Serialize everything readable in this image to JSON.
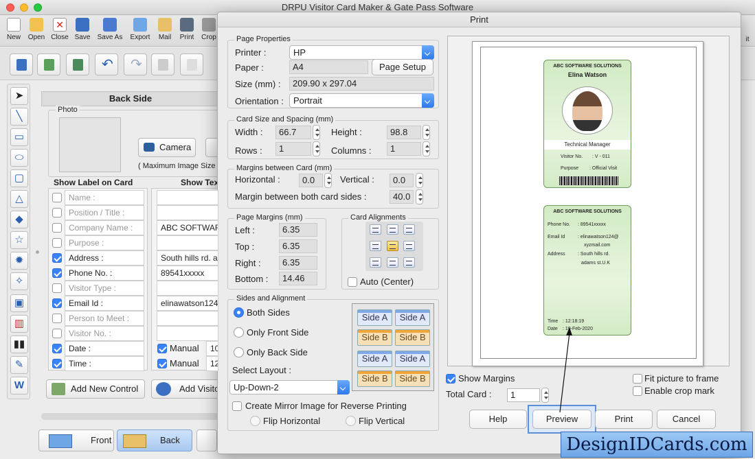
{
  "app_title": "DRPU Visitor Card Maker & Gate Pass Software",
  "toolbar": {
    "items": [
      {
        "label": "New"
      },
      {
        "label": "Open"
      },
      {
        "label": "Close"
      },
      {
        "label": "Save"
      },
      {
        "label": "Save As"
      },
      {
        "label": "Export"
      },
      {
        "label": "Mail"
      },
      {
        "label": "Print"
      },
      {
        "label": "Crop"
      }
    ],
    "exit_fragment": "it"
  },
  "editor": {
    "back_side_title": "Back Side",
    "photo_label": "Photo",
    "camera_button": "Camera",
    "max_image_size": "( Maximum Image Size",
    "show_label_header": "Show Label on Card",
    "show_text_header": "Show Tex",
    "labels": [
      {
        "text": "Name :",
        "checked": false,
        "value": "",
        "enabled": false
      },
      {
        "text": "Position / Title :",
        "checked": false,
        "value": "",
        "enabled": false
      },
      {
        "text": "Company Name :",
        "checked": false,
        "value": "ABC SOFTWAR",
        "enabled": false
      },
      {
        "text": "Purpose :",
        "checked": false,
        "value": "",
        "enabled": false
      },
      {
        "text": "Address      :",
        "checked": true,
        "value": "South hills rd. a",
        "enabled": true
      },
      {
        "text": "Phone No. :",
        "checked": true,
        "value": "89541xxxxx",
        "enabled": true
      },
      {
        "text": "Visitor Type :",
        "checked": false,
        "value": "",
        "enabled": false
      },
      {
        "text": "Email Id      :",
        "checked": true,
        "value": "elinawatson124",
        "enabled": true
      },
      {
        "text": "Person to Meet :",
        "checked": false,
        "value": "",
        "enabled": false
      },
      {
        "text": "Visitor No. :",
        "checked": false,
        "value": "",
        "enabled": false
      },
      {
        "text": "Date   :",
        "checked": true,
        "value": "",
        "enabled": true,
        "manual": "Manual",
        "manual_value": "10"
      },
      {
        "text": "Time   :",
        "checked": true,
        "value": "",
        "enabled": true,
        "manual": "Manual",
        "manual_value": "12"
      }
    ],
    "add_new_control": "Add New Control",
    "add_visitor": "Add Visito"
  },
  "bottom_tabs": {
    "front": "Front",
    "back": "Back"
  },
  "dialog": {
    "title": "Print",
    "page_properties": {
      "group": "Page Properties",
      "printer_label": "Printer :",
      "printer": "HP",
      "paper_label": "Paper :",
      "paper": "A4",
      "page_setup": "Page Setup",
      "size_label": "Size (mm) :",
      "size": "209.90 x 297.04",
      "orientation_label": "Orientation :",
      "orientation": "Portrait"
    },
    "card_size": {
      "group": "Card Size and Spacing (mm)",
      "width_label": "Width :",
      "width": "66.7",
      "height_label": "Height :",
      "height": "98.8",
      "rows_label": "Rows :",
      "rows": "1",
      "columns_label": "Columns :",
      "columns": "1"
    },
    "margins_card": {
      "group": "Margins between Card (mm)",
      "horizontal_label": "Horizontal :",
      "horizontal": "0.0",
      "vertical_label": "Vertical :",
      "vertical": "0.0",
      "both_label": "Margin between both card sides :",
      "both": "40.0"
    },
    "page_margins": {
      "group": "Page Margins (mm)",
      "left_label": "Left :",
      "left": "6.35",
      "top_label": "Top :",
      "top": "6.35",
      "right_label": "Right :",
      "right": "6.35",
      "bottom_label": "Bottom :",
      "bottom": "14.46"
    },
    "card_alignments": {
      "group": "Card Alignments",
      "auto_center": "Auto (Center)"
    },
    "sides": {
      "group": "Sides and Alignment",
      "both": "Both Sides",
      "front": "Only Front Side",
      "back": "Only Back Side",
      "select_layout_label": "Select Layout :",
      "layout": "Up-Down-2",
      "layout_tiles": [
        "Side A",
        "Side A",
        "Side B",
        "Side B",
        "Side A",
        "Side A",
        "Side B",
        "Side B"
      ]
    },
    "mirror": {
      "label": "Create Mirror Image for Reverse Printing",
      "flip_h": "Flip Horizontal",
      "flip_v": "Flip Vertical"
    },
    "options": {
      "show_margins": "Show Margins",
      "fit_picture": "Fit picture to frame",
      "enable_crop": "Enable crop mark",
      "total_card_label": "Total Card :",
      "total_card": "1"
    },
    "buttons": {
      "help": "Help",
      "preview": "Preview",
      "print": "Print",
      "cancel": "Cancel"
    },
    "preview_cards": {
      "front": {
        "company": "ABC SOFTWARE SOLUTIONS",
        "name": "Elina Watson",
        "title": "Technical Manager",
        "visitor_no_label": "Visitor No.",
        "visitor_no": ":   V - 011",
        "purpose_label": "Purpose",
        "purpose": ":  Official Visit"
      },
      "back": {
        "company": "ABC SOFTWARE SOLUTIONS",
        "phone_label": "Phone No.",
        "phone": ":  89541xxxxx",
        "email_label": "Email Id",
        "email1": ":  elinawatson124@",
        "email2": "xyzmail.com",
        "address_label": "Address",
        "address1": ":  South hills rd.",
        "address2": "adams st.U.K",
        "time_label": "Time",
        "time": ":  12:18:19",
        "date_label": "Date",
        "date": ":  10-Feb-2020"
      }
    }
  },
  "watermark": "DesignIDCards.com",
  "colors": {
    "accent": "#3a82f7",
    "card_green": "#d2ebc4",
    "watermark_bg": "#7fb3ec"
  }
}
